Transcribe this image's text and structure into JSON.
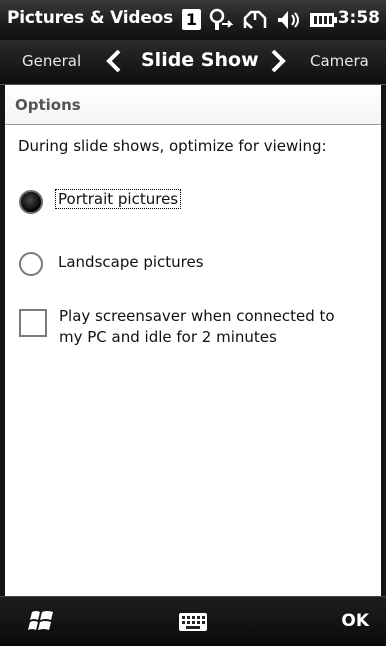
{
  "status_bar": {
    "app_title": "Pictures & Videos",
    "badge": "1",
    "time": "3:58",
    "icons": [
      "notification-badge-icon",
      "network-sync-icon",
      "signal-icon",
      "speaker-icon",
      "battery-icon"
    ]
  },
  "tab_bar": {
    "previous_tab": "General",
    "current_tab": "Slide Show",
    "next_tab": "Camera"
  },
  "section": {
    "title": "Options"
  },
  "instruction": "During slide shows, optimize for viewing:",
  "options": [
    {
      "label": "Portrait pictures",
      "selected": true
    },
    {
      "label": "Landscape pictures",
      "selected": false
    }
  ],
  "screensaver": {
    "label": "Play screensaver when connected to my PC and idle for 2 minutes",
    "checked": false
  },
  "bottom_bar": {
    "left_icon": "windows-start-icon",
    "center_icon": "keyboard-icon",
    "ok_label": "OK"
  }
}
